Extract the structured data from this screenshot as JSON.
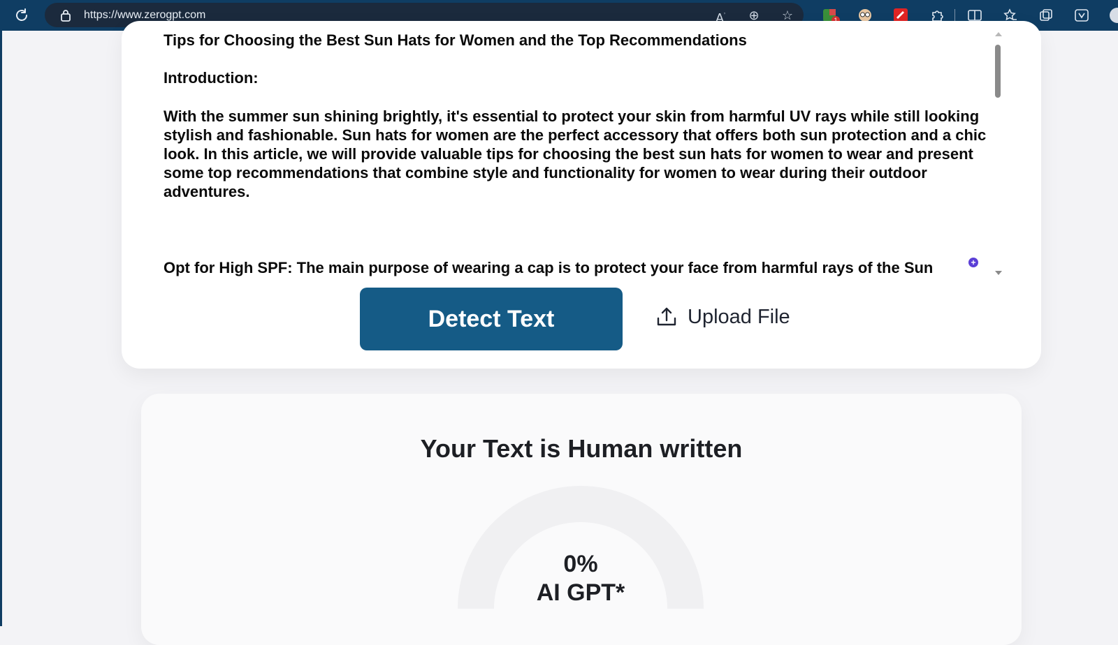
{
  "browser": {
    "url": "https://www.zerogpt.com",
    "extension_badge_count": "1"
  },
  "input": {
    "title": "Tips for Choosing the Best Sun Hats for Women and the Top Recommendations",
    "intro_heading": "Introduction:",
    "intro_body": "With the summer sun shining brightly, it's essential to protect your skin from harmful UV rays while still looking stylish and fashionable. Sun hats for women are the perfect accessory that offers both sun protection and a chic look. In this article, we will provide valuable tips for choosing the best sun hats for women to wear and present some top recommendations that combine style and functionality for women to wear during their outdoor adventures.",
    "partial_line": "Opt for High SPF: The main purpose of wearing a cap is to protect your face from harmful rays of the Sun"
  },
  "actions": {
    "detect_label": "Detect Text",
    "upload_label": "Upload File"
  },
  "result": {
    "verdict": "Your Text is Human written",
    "percent": "0%",
    "metric_label": "AI GPT*",
    "ai_fraction": 0.0
  },
  "colors": {
    "chrome": "#0f3d63",
    "primary_button": "#155b86",
    "gauge_track": "#f0f0f2"
  }
}
